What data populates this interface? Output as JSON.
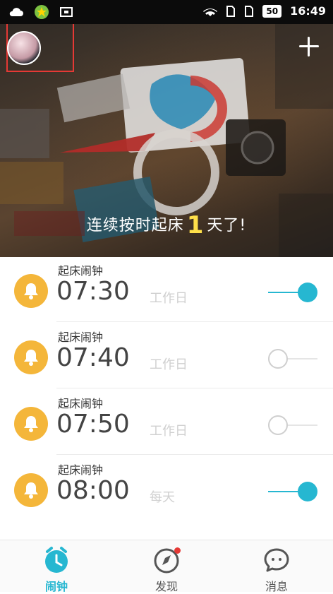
{
  "status_bar": {
    "icons": [
      "cloud-icon",
      "app-icon",
      "screenshot-icon",
      "wifi-icon",
      "sim1-icon",
      "sim2-icon"
    ],
    "battery": "50",
    "time": "16:49"
  },
  "header": {
    "avatar_icon": "avatar-icon",
    "add_icon": "plus-icon",
    "streak_prefix": "连续按时起床",
    "streak_days": "1",
    "streak_suffix": "天了!"
  },
  "alarms": [
    {
      "label": "起床闹钟",
      "time": "07:30",
      "repeat": "工作日",
      "enabled": true
    },
    {
      "label": "起床闹钟",
      "time": "07:40",
      "repeat": "工作日",
      "enabled": false
    },
    {
      "label": "起床闹钟",
      "time": "07:50",
      "repeat": "工作日",
      "enabled": false
    },
    {
      "label": "起床闹钟",
      "time": "08:00",
      "repeat": "每天",
      "enabled": true
    }
  ],
  "tabs": [
    {
      "label": "闹钟",
      "icon": "clock-icon",
      "active": true
    },
    {
      "label": "发现",
      "icon": "compass-icon",
      "active": false,
      "badge": true
    },
    {
      "label": "消息",
      "icon": "chat-bubble-icon",
      "active": false
    }
  ],
  "colors": {
    "accent": "#26b7d1",
    "bell": "#f4b63a",
    "badge": "#e53935",
    "streak": "#ffe04a"
  }
}
